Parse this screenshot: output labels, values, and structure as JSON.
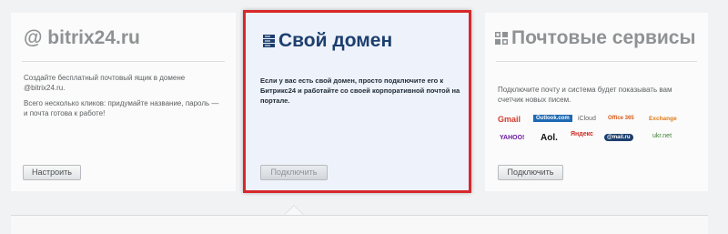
{
  "cards": [
    {
      "title": "@ bitrix24.ru",
      "desc": [
        "Создайте бесплатный почтовый ящик в домене @bitrix24.ru.",
        "Всего несколько кликов: придумайте название, пароль — и почта готова к работе!"
      ],
      "button": "Настроить"
    },
    {
      "title": "Свой домен",
      "icon": "server-icon",
      "desc": "Если у вас есть свой домен, просто подключите его к Битрикс24 и работайте со своей корпоративной почтой на портале.",
      "button": "Подключить"
    },
    {
      "title": "Почтовые сервисы",
      "icon": "mail-services-icon",
      "desc": "Подключите почту и система будет показывать вам счетчик новых писем.",
      "button": "Подключить",
      "logos": [
        "Gmail",
        "Outlook.com",
        "iCloud",
        "Office 365",
        "Exchange",
        "YAHOO!",
        "Aol.",
        "Яндекс",
        "@mail.ru",
        "ukr.net"
      ]
    }
  ],
  "colors": {
    "accent_border": "#d6292b",
    "title_active": "#1d3f6e",
    "title_inactive": "#8f9294"
  }
}
